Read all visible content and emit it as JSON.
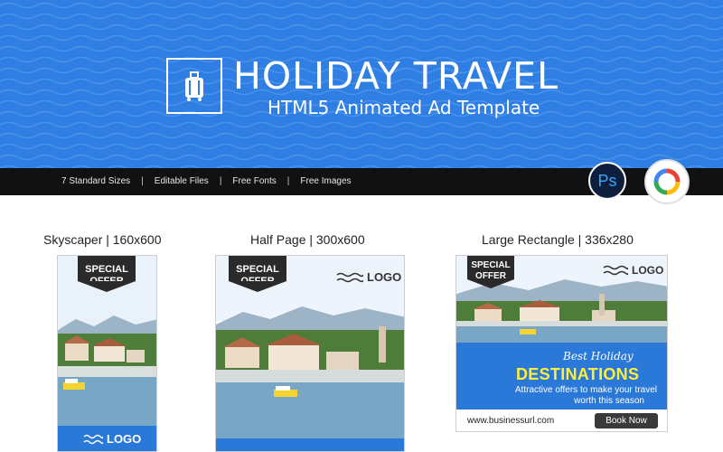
{
  "hero": {
    "title": "HOLIDAY TRAVEL",
    "subtitle": "HTML5 Animated Ad Template",
    "icon": "suitcase-icon",
    "background_color": "#2f7ee3"
  },
  "features": [
    "7 Standard Sizes",
    "Editable Files",
    "Free Fonts",
    "Free Images"
  ],
  "feature_separator": "|",
  "apps": {
    "photoshop_label": "Ps",
    "google_web_designer_icon": "google-web-designer-icon"
  },
  "ads": {
    "skyscraper": {
      "title": "Skyscaper | 160x600",
      "badge_line1": "SPECIAL",
      "badge_line2": "OFFER",
      "logo": "LOGO"
    },
    "half_page": {
      "title": "Half Page | 300x600",
      "badge_line1": "SPECIAL",
      "badge_line2": "OFFER",
      "logo": "LOGO"
    },
    "large_rectangle": {
      "title": "Large Rectangle | 336x280",
      "badge_line1": "SPECIAL",
      "badge_line2": "OFFER",
      "logo": "LOGO",
      "tagline": "Best Holiday",
      "headline": "DESTINATIONS",
      "offer_line1": "Attractive offers to make your travel",
      "offer_line2": "worth this season",
      "url": "www.businessurl.com",
      "cta": "Book Now"
    }
  },
  "colors": {
    "brand_blue": "#2a78d8",
    "headline_yellow": "#ffef3a",
    "dark": "#2a2a2a"
  }
}
